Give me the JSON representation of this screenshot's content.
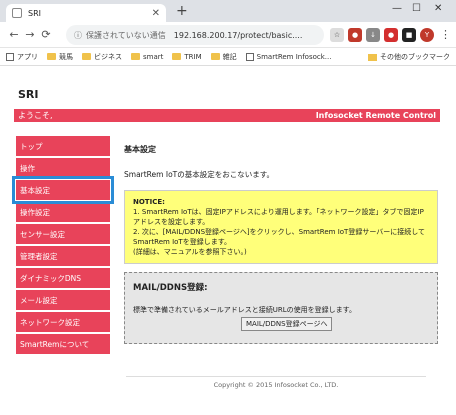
{
  "browser": {
    "tab_title": "SRI",
    "address_security": "保護されていない通信",
    "address_url": "192.168.200.17/protect/basic....",
    "bookmarks": [
      {
        "label": "アプリ"
      },
      {
        "label": "競馬"
      },
      {
        "label": "ビジネス"
      },
      {
        "label": "smart"
      },
      {
        "label": "TRIM"
      },
      {
        "label": "雑記"
      },
      {
        "label": "SmartRem Infosock..."
      }
    ],
    "bookmarks_other": "その他のブックマーク"
  },
  "page": {
    "brand": "SRI",
    "welcome": "ようこそ,",
    "header_right": "Infosocket Remote Control",
    "sidebar": [
      {
        "label": "トップ"
      },
      {
        "label": "操作"
      },
      {
        "label": "基本設定"
      },
      {
        "label": "操作設定"
      },
      {
        "label": "センサー設定"
      },
      {
        "label": "管理者設定"
      },
      {
        "label": "ダイナミックDNS"
      },
      {
        "label": "メール設定"
      },
      {
        "label": "ネットワーク設定"
      },
      {
        "label": "SmartRemについて"
      }
    ],
    "content": {
      "title": "基本設定",
      "description": "SmartRem IoTの基本設定をおこないます。",
      "notice": {
        "title": "NOTICE:",
        "line1": "1. SmartRem IoTは、固定IPアドレスにより運用します。「ネットワーク設定」タブで固定IPアドレスを設定します。",
        "line2": "2. 次に、[MAIL/DDNS登録ページへ]をクリックし、SmartRem IoT登録サーバーに接続してSmartRem IoTを登録します。",
        "line3": "(詳細は、マニュアルを参照下さい。)"
      },
      "mail": {
        "title": "MAIL/DDNS登録:",
        "text": "標準で準備されているメールアドレスと接続URLの使用を登録します。",
        "button": "MAIL/DDNS登録ページへ"
      }
    },
    "footer": "Copyright © 2015 Infosocket Co., LTD."
  }
}
